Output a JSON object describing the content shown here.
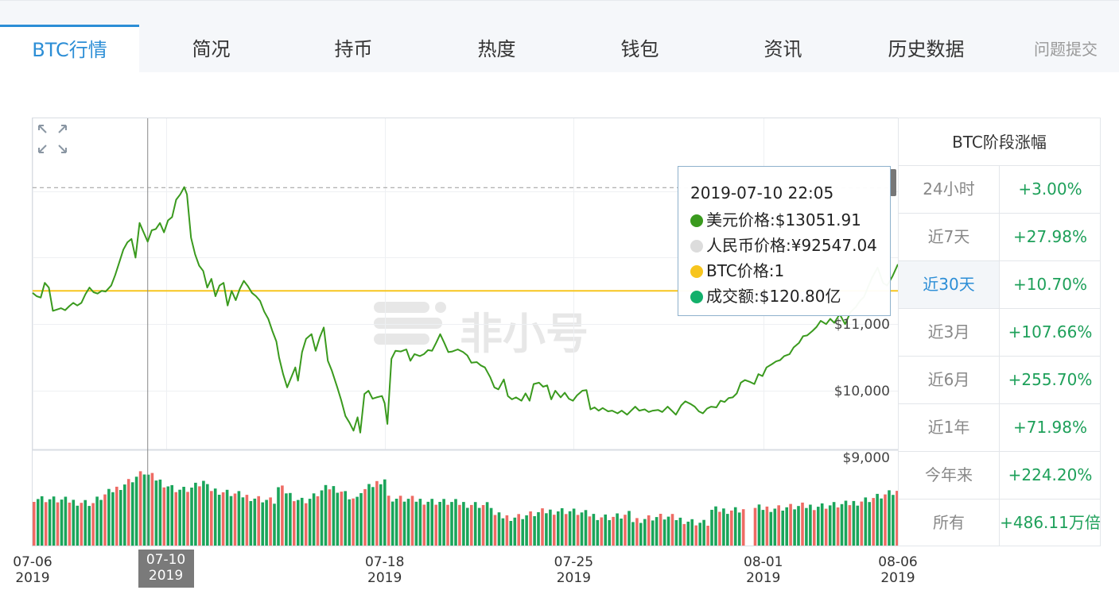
{
  "tabs": [
    {
      "label": "BTC行情",
      "active": true
    },
    {
      "label": "简况"
    },
    {
      "label": "持币"
    },
    {
      "label": "热度"
    },
    {
      "label": "钱包"
    },
    {
      "label": "资讯"
    },
    {
      "label": "历史数据"
    }
  ],
  "feedback_label": "问题提交",
  "watermark": "非小号",
  "tooltip": {
    "time": "2019-07-10 22:05",
    "usd": "美元价格:$13051.91",
    "cny": "人民币价格:¥92547.04",
    "btc": "BTC价格:1",
    "volume": "成交额:$120.80亿"
  },
  "stats": {
    "title": "BTC阶段涨幅",
    "rows": [
      {
        "label": "24小时",
        "value": "+3.00%"
      },
      {
        "label": "近7天",
        "value": "+27.98%"
      },
      {
        "label": "近30天",
        "value": "+10.70%",
        "selected": true
      },
      {
        "label": "近3月",
        "value": "+107.66%"
      },
      {
        "label": "近6月",
        "value": "+255.70%"
      },
      {
        "label": "近1年",
        "value": "+71.98%"
      },
      {
        "label": "今年来",
        "value": "+224.20%"
      },
      {
        "label": "所有",
        "value": "+486.11万倍"
      }
    ]
  },
  "colors": {
    "price_line": "#3a9a1e",
    "reference_line": "#f7c51e",
    "volume_up": "#1aa55a",
    "volume_down": "#ee6b64",
    "accent": "#2c8ed6"
  },
  "chart_data": {
    "type": "line",
    "price_ticks": [
      "$11,000",
      "$10,000",
      "$9,000"
    ],
    "price_tick_values": [
      11000,
      10000,
      9000
    ],
    "dates": [
      {
        "md": "07-06",
        "y": "2019",
        "t": 0
      },
      {
        "md": "07-10",
        "y": "2019",
        "t": 4.92,
        "highlight": true
      },
      {
        "md": "07-18",
        "y": "2019",
        "t": 13.0
      },
      {
        "md": "07-25",
        "y": "2019",
        "t": 19.98
      },
      {
        "md": "08-01",
        "y": "2019",
        "t": 26.98
      },
      {
        "md": "08-06",
        "y": "2019",
        "t": 31.95
      }
    ],
    "reference_price": 11500,
    "crosshair_t": 4.25,
    "crosshair_price": 13051.91,
    "series": [
      {
        "price": [
          [
            0.0,
            11470
          ],
          [
            0.15,
            11420
          ],
          [
            0.3,
            11400
          ],
          [
            0.45,
            11620
          ],
          [
            0.6,
            11550
          ],
          [
            0.75,
            11200
          ],
          [
            0.9,
            11220
          ],
          [
            1.05,
            11240
          ],
          [
            1.2,
            11210
          ],
          [
            1.35,
            11270
          ],
          [
            1.5,
            11320
          ],
          [
            1.65,
            11280
          ],
          [
            1.8,
            11320
          ],
          [
            1.95,
            11450
          ],
          [
            2.1,
            11550
          ],
          [
            2.25,
            11480
          ],
          [
            2.4,
            11460
          ],
          [
            2.55,
            11500
          ],
          [
            2.7,
            11490
          ],
          [
            2.9,
            11580
          ],
          [
            3.05,
            11740
          ],
          [
            3.2,
            11930
          ],
          [
            3.35,
            12120
          ],
          [
            3.5,
            12230
          ],
          [
            3.65,
            12280
          ],
          [
            3.8,
            12000
          ],
          [
            3.95,
            12520
          ],
          [
            4.1,
            12380
          ],
          [
            4.25,
            12240
          ],
          [
            4.4,
            12410
          ],
          [
            4.55,
            12430
          ],
          [
            4.7,
            12520
          ],
          [
            4.85,
            12380
          ],
          [
            5.0,
            12560
          ],
          [
            5.15,
            12610
          ],
          [
            5.3,
            12870
          ],
          [
            5.45,
            12950
          ],
          [
            5.6,
            13060
          ],
          [
            5.7,
            12950
          ],
          [
            5.85,
            12300
          ],
          [
            6.0,
            12050
          ],
          [
            6.15,
            11880
          ],
          [
            6.3,
            11800
          ],
          [
            6.45,
            11550
          ],
          [
            6.6,
            11680
          ],
          [
            6.75,
            11420
          ],
          [
            6.9,
            11580
          ],
          [
            7.05,
            11620
          ],
          [
            7.2,
            11280
          ],
          [
            7.35,
            11500
          ],
          [
            7.5,
            11360
          ],
          [
            7.65,
            11530
          ],
          [
            7.8,
            11650
          ],
          [
            7.95,
            11570
          ],
          [
            8.1,
            11470
          ],
          [
            8.25,
            11420
          ],
          [
            8.4,
            11350
          ],
          [
            8.55,
            11190
          ],
          [
            8.7,
            11080
          ],
          [
            8.85,
            10900
          ],
          [
            9.0,
            10740
          ],
          [
            9.1,
            10500
          ],
          [
            9.25,
            10250
          ],
          [
            9.4,
            10050
          ],
          [
            9.55,
            10200
          ],
          [
            9.7,
            10350
          ],
          [
            9.8,
            10150
          ],
          [
            9.95,
            10580
          ],
          [
            10.1,
            10780
          ],
          [
            10.3,
            10850
          ],
          [
            10.45,
            10600
          ],
          [
            10.6,
            10800
          ],
          [
            10.75,
            10950
          ],
          [
            10.9,
            10450
          ],
          [
            11.05,
            10300
          ],
          [
            11.25,
            10050
          ],
          [
            11.4,
            9850
          ],
          [
            11.55,
            9620
          ],
          [
            11.7,
            9520
          ],
          [
            11.85,
            9400
          ],
          [
            12.0,
            9600
          ],
          [
            12.1,
            9370
          ],
          [
            12.25,
            9950
          ],
          [
            12.4,
            10000
          ],
          [
            12.55,
            9880
          ],
          [
            12.7,
            9900
          ],
          [
            12.9,
            9920
          ],
          [
            13.0,
            9810
          ],
          [
            13.1,
            9500
          ],
          [
            13.25,
            10480
          ],
          [
            13.4,
            10600
          ],
          [
            13.6,
            10590
          ],
          [
            13.8,
            10620
          ],
          [
            13.95,
            10450
          ],
          [
            14.1,
            10550
          ],
          [
            14.3,
            10520
          ],
          [
            14.45,
            10550
          ],
          [
            14.6,
            10610
          ],
          [
            14.75,
            10600
          ],
          [
            14.9,
            10720
          ],
          [
            15.05,
            10850
          ],
          [
            15.2,
            10720
          ],
          [
            15.35,
            10580
          ],
          [
            15.5,
            10590
          ],
          [
            15.7,
            10620
          ],
          [
            15.9,
            10580
          ],
          [
            16.05,
            10530
          ],
          [
            16.2,
            10420
          ],
          [
            16.4,
            10430
          ],
          [
            16.55,
            10380
          ],
          [
            16.7,
            10350
          ],
          [
            16.9,
            10200
          ],
          [
            17.05,
            10050
          ],
          [
            17.2,
            10020
          ],
          [
            17.4,
            10170
          ],
          [
            17.55,
            9920
          ],
          [
            17.7,
            9870
          ],
          [
            17.85,
            9900
          ],
          [
            18.05,
            9850
          ],
          [
            18.2,
            9960
          ],
          [
            18.35,
            9850
          ],
          [
            18.5,
            10100
          ],
          [
            18.7,
            10120
          ],
          [
            18.85,
            10060
          ],
          [
            19.0,
            10080
          ],
          [
            19.15,
            9870
          ],
          [
            19.3,
            10000
          ],
          [
            19.5,
            9900
          ],
          [
            19.65,
            9970
          ],
          [
            19.8,
            9880
          ],
          [
            19.95,
            9850
          ],
          [
            20.1,
            9930
          ],
          [
            20.3,
            10000
          ],
          [
            20.45,
            10010
          ],
          [
            20.6,
            9720
          ],
          [
            20.75,
            9750
          ],
          [
            20.9,
            9700
          ],
          [
            21.05,
            9740
          ],
          [
            21.25,
            9690
          ],
          [
            21.4,
            9700
          ],
          [
            21.6,
            9660
          ],
          [
            21.75,
            9700
          ],
          [
            21.95,
            9640
          ],
          [
            22.1,
            9700
          ],
          [
            22.25,
            9760
          ],
          [
            22.4,
            9700
          ],
          [
            22.6,
            9720
          ],
          [
            22.75,
            9680
          ],
          [
            22.9,
            9700
          ],
          [
            23.1,
            9710
          ],
          [
            23.25,
            9680
          ],
          [
            23.45,
            9760
          ],
          [
            23.6,
            9700
          ],
          [
            23.75,
            9640
          ],
          [
            23.95,
            9780
          ],
          [
            24.1,
            9840
          ],
          [
            24.3,
            9800
          ],
          [
            24.45,
            9760
          ],
          [
            24.6,
            9690
          ],
          [
            24.75,
            9660
          ],
          [
            24.9,
            9730
          ],
          [
            25.05,
            9760
          ],
          [
            25.25,
            9750
          ],
          [
            25.4,
            9850
          ],
          [
            25.55,
            9830
          ],
          [
            25.7,
            9890
          ],
          [
            25.85,
            9900
          ],
          [
            26.0,
            9960
          ],
          [
            26.15,
            10120
          ],
          [
            26.3,
            10160
          ],
          [
            26.5,
            10130
          ],
          [
            26.65,
            10100
          ],
          [
            26.8,
            10250
          ],
          [
            26.95,
            10220
          ],
          [
            27.1,
            10350
          ],
          [
            27.3,
            10400
          ],
          [
            27.45,
            10440
          ],
          [
            27.6,
            10460
          ],
          [
            27.75,
            10520
          ],
          [
            27.95,
            10550
          ],
          [
            28.1,
            10650
          ],
          [
            28.3,
            10720
          ],
          [
            28.45,
            10820
          ],
          [
            28.6,
            10830
          ],
          [
            28.8,
            10900
          ],
          [
            28.95,
            10960
          ],
          [
            29.1,
            11050
          ],
          [
            29.3,
            11000
          ],
          [
            29.45,
            11080
          ],
          [
            29.6,
            11020
          ],
          [
            29.8,
            11150
          ],
          [
            30.0,
            11000
          ],
          [
            30.2,
            11180
          ],
          [
            30.4,
            11260
          ],
          [
            30.55,
            11350
          ],
          [
            30.7,
            11410
          ],
          [
            30.85,
            11560
          ],
          [
            31.0,
            11700
          ],
          [
            31.2,
            11850
          ],
          [
            31.4,
            11620
          ],
          [
            31.55,
            11580
          ],
          [
            31.75,
            11720
          ],
          [
            31.95,
            11900
          ]
        ]
      }
    ],
    "volume": {
      "start_t": 0.0,
      "step_t": 0.1455,
      "gap_t": [
        26.25,
        26.5
      ],
      "up_down_pattern": "mixed"
    }
  }
}
